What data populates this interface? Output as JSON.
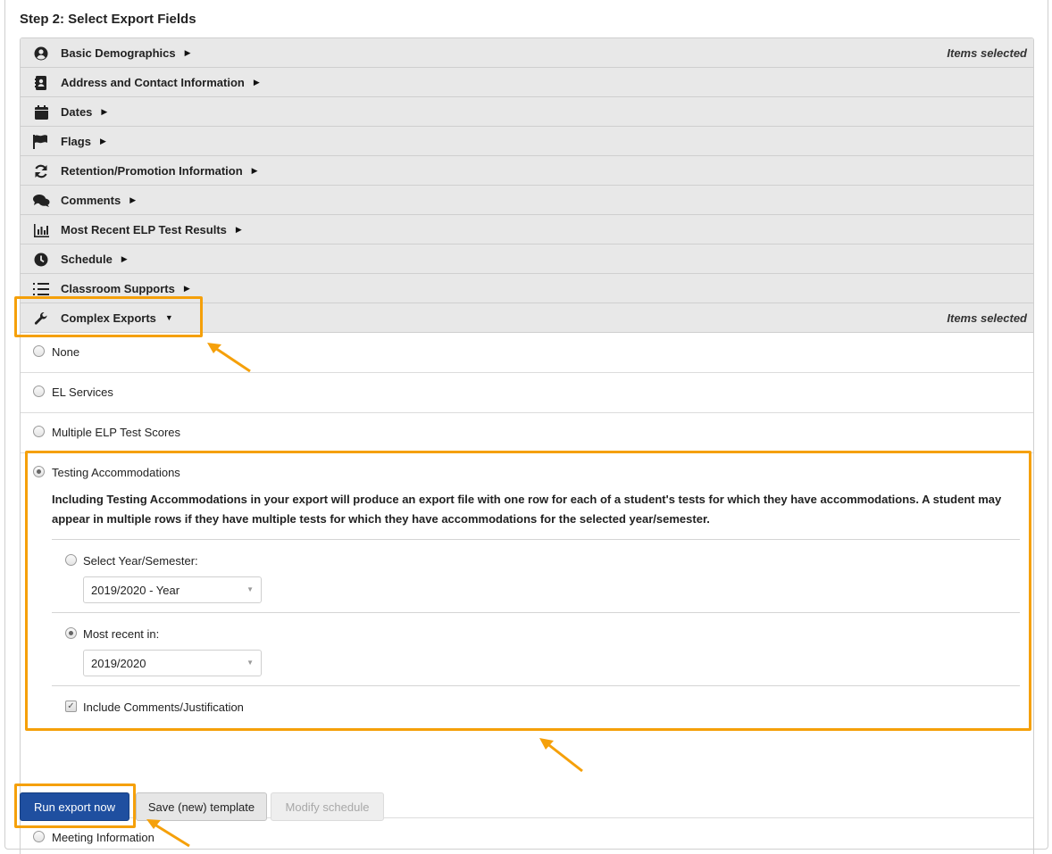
{
  "step": {
    "title": "Step 2: Select Export Fields"
  },
  "sections": [
    {
      "label": "Basic Demographics",
      "icon": "user-circle-icon",
      "selected_note": "Items selected"
    },
    {
      "label": "Address and Contact Information",
      "icon": "address-book-icon"
    },
    {
      "label": "Dates",
      "icon": "calendar-icon"
    },
    {
      "label": "Flags",
      "icon": "flag-icon"
    },
    {
      "label": "Retention/Promotion Information",
      "icon": "sync-icon"
    },
    {
      "label": "Comments",
      "icon": "comments-icon"
    },
    {
      "label": "Most Recent ELP Test Results",
      "icon": "bar-chart-icon"
    },
    {
      "label": "Schedule",
      "icon": "clock-icon"
    },
    {
      "label": "Classroom Supports",
      "icon": "list-icon"
    },
    {
      "label": "Complex Exports",
      "icon": "wrench-icon",
      "selected_note": "Items selected",
      "expanded": true
    }
  ],
  "complex": {
    "options": {
      "none": "None",
      "el_services": "EL Services",
      "multiple_elp": "Multiple ELP Test Scores",
      "testing_accommodations": "Testing Accommodations",
      "meeting_information": "Meeting Information"
    },
    "selected": "Testing Accommodations",
    "description": "Including Testing Accommodations in your export will produce an export file with one row for each of a student's tests for which they have accommodations. A student may appear in multiple rows if they have multiple tests for which they have accommodations for the selected year/semester.",
    "year_semester_label": "Select Year/Semester:",
    "year_semester_value": "2019/2020 - Year",
    "most_recent_label": "Most recent in:",
    "most_recent_value": "2019/2020",
    "include_comments_label": "Include Comments/Justification",
    "include_comments_checked": true
  },
  "buttons": {
    "run": "Run export now",
    "save": "Save (new) template",
    "modify": "Modify schedule"
  },
  "colors": {
    "accent": "#1f4fa0",
    "highlight": "#f5a00a",
    "header_bg": "#e8e8e8"
  }
}
